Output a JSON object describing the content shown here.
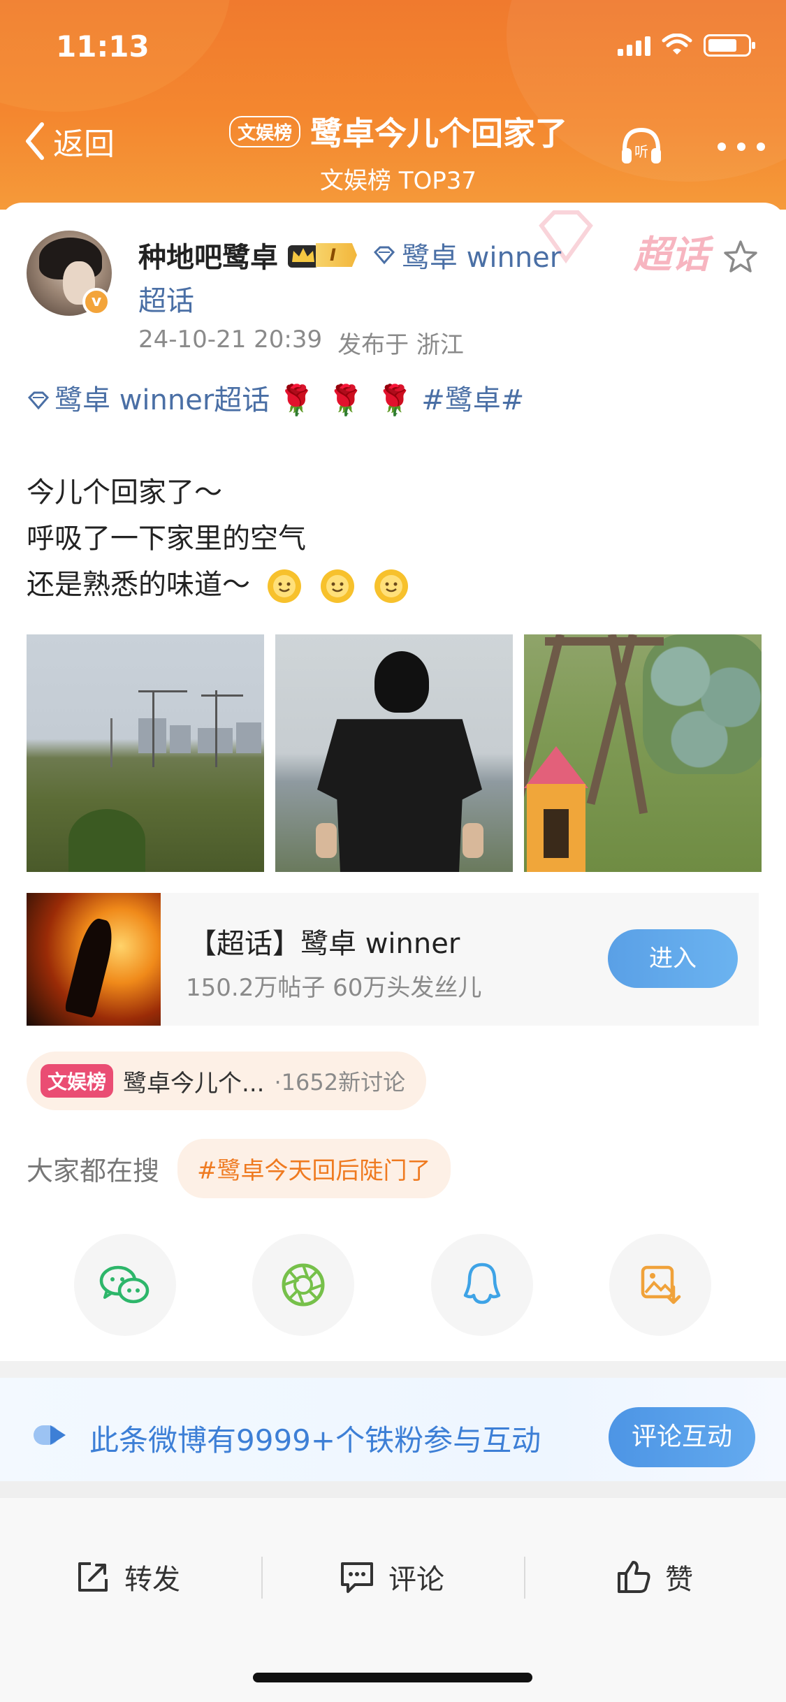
{
  "status_bar": {
    "time": "11:13"
  },
  "nav": {
    "back_label": "返回",
    "badge": "文娱榜",
    "title": "鹭卓今儿个回家了",
    "subtitle": "文娱榜 TOP37"
  },
  "post": {
    "watermark": "超话",
    "author": "种地吧鹭卓",
    "vip_level": "I",
    "topic_name": "鹭卓 winner",
    "topic_suffix": "超话",
    "date": "24-10-21 20:39",
    "location": "发布于 浙江",
    "tag_topic": "鹭卓 winner超话",
    "roses": [
      "🌹",
      "🌹",
      "🌹"
    ],
    "hashtag": "#鹭卓#",
    "lines": [
      "今儿个回家了～",
      "呼吸了一下家里的空气",
      "还是熟悉的味道～"
    ]
  },
  "promo": {
    "title": "【超话】鹭卓 winner",
    "stats": "150.2万帖子 60万头发丝儿",
    "button": "进入"
  },
  "rank": {
    "badge": "文娱榜",
    "text": "鹭卓今儿个...",
    "count": "·1652新讨论"
  },
  "search": {
    "label": "大家都在搜",
    "tag": "#鹭卓今天回后陡门了"
  },
  "share_icons": [
    "wechat-icon",
    "moments-icon",
    "qq-icon",
    "save-image-icon"
  ],
  "fan_bar": {
    "text": "此条微博有9999+个铁粉参与互动",
    "button": "评论互动"
  },
  "actions": {
    "repost": "转发",
    "comment": "评论",
    "like": "赞"
  },
  "colors": {
    "header": "#f07a2e",
    "link": "#4a6fa5",
    "accent_blue": "#3d7fd6",
    "orange_text": "#ef7a20",
    "rank_badge": "#ea4d73"
  }
}
